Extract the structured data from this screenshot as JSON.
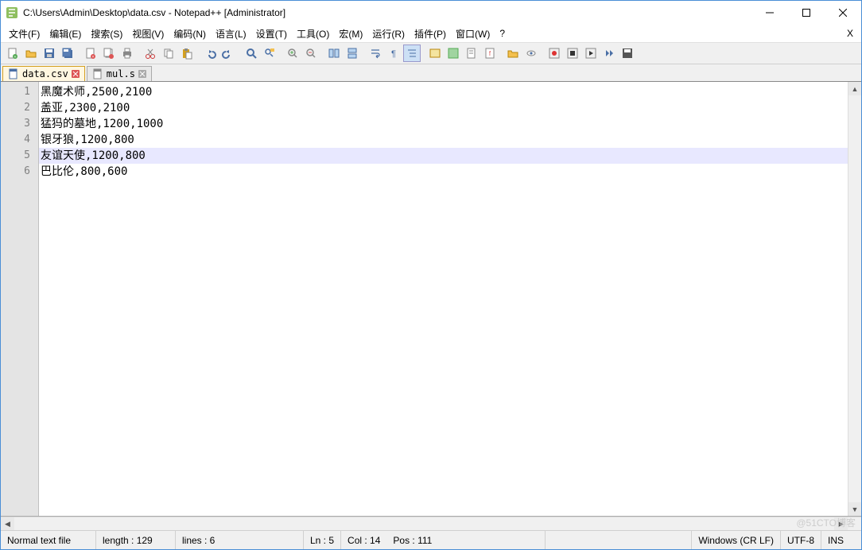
{
  "window": {
    "title": "C:\\Users\\Admin\\Desktop\\data.csv - Notepad++ [Administrator]"
  },
  "menu": {
    "file": "文件(F)",
    "edit": "编辑(E)",
    "search": "搜索(S)",
    "view": "视图(V)",
    "encoding": "编码(N)",
    "language": "语言(L)",
    "settings": "设置(T)",
    "tools": "工具(O)",
    "macro": "宏(M)",
    "run": "运行(R)",
    "plugins": "插件(P)",
    "window": "窗口(W)",
    "help": "?"
  },
  "tabs": [
    {
      "label": "data.csv",
      "active": true
    },
    {
      "label": "mul.s",
      "active": false
    }
  ],
  "editor": {
    "lines": [
      "黑魔术师,2500,2100",
      "盖亚,2300,2100",
      "猛犸的墓地,1200,1000",
      "银牙狼,1200,800",
      "友谊天使,1200,800",
      "巴比伦,800,600"
    ],
    "highlightLine": 5
  },
  "status": {
    "filetype": "Normal text file",
    "length": "length : 129",
    "lines": "lines : 6",
    "ln": "Ln : 5",
    "col": "Col : 14",
    "pos": "Pos : 111",
    "eol": "Windows (CR LF)",
    "encoding": "UTF-8",
    "mode": "INS"
  },
  "watermark": "@51CTO博客"
}
